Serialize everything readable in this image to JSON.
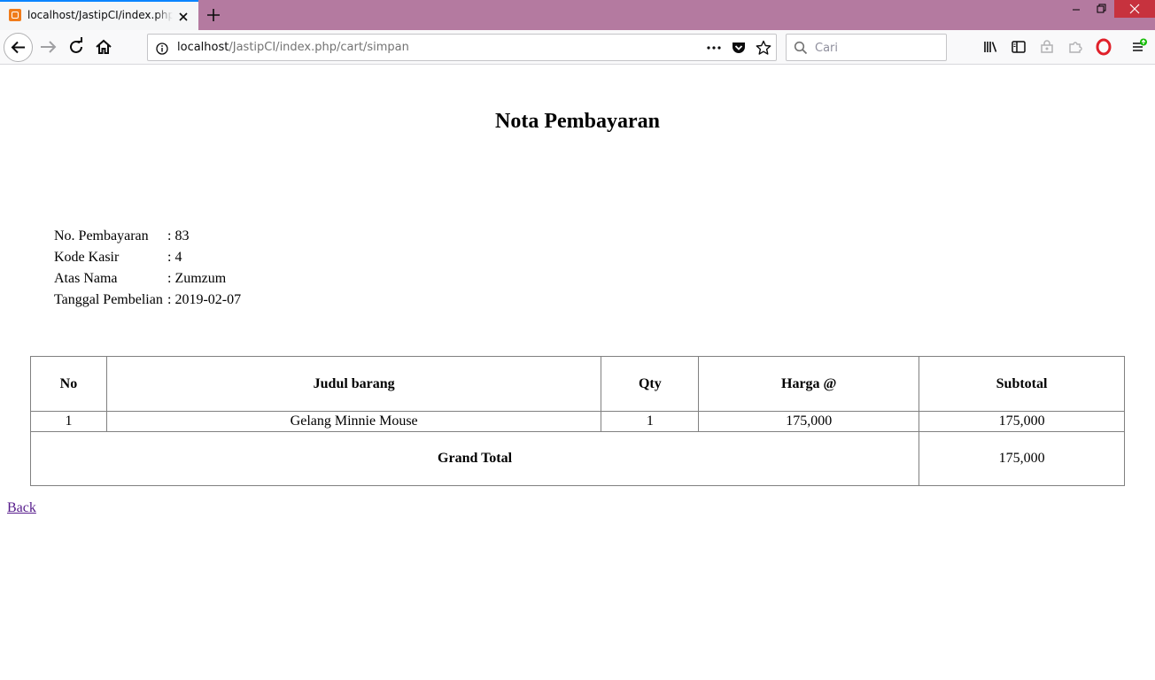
{
  "browser": {
    "tab": {
      "title": "localhost/JastipCI/index.php/cart/simpan"
    },
    "url": {
      "host": "localhost",
      "path": "/JastipCI/index.php/cart/simpan"
    },
    "search": {
      "placeholder": "Cari"
    },
    "icons": {
      "back": "back-arrow-icon",
      "forward": "forward-arrow-icon",
      "reload": "reload-icon",
      "home": "home-icon",
      "info": "info-icon",
      "page-actions": "more-dots-icon",
      "pocket": "pocket-icon",
      "bookmark": "star-icon",
      "library": "library-icon",
      "sidebar": "sidebar-icon",
      "menu": "hamburger-icon"
    },
    "accent_color": "#0a84ff",
    "titlebar_color": "#b47aa0"
  },
  "page": {
    "title": "Nota Pembayaran",
    "info": [
      {
        "label": "No. Pembayaran",
        "value": ": 83"
      },
      {
        "label": "Kode Kasir",
        "value": ": 4"
      },
      {
        "label": "Atas Nama",
        "value": ": Zumzum"
      },
      {
        "label": "Tanggal Pembelian",
        "value": ": 2019-02-07"
      }
    ],
    "table": {
      "headers": [
        "No",
        "Judul barang",
        "Qty",
        "Harga @",
        "Subtotal"
      ],
      "rows": [
        [
          "1",
          "Gelang Minnie Mouse",
          "1",
          "175,000",
          "175,000"
        ]
      ],
      "grand_total_label": "Grand Total",
      "grand_total_value": "175,000"
    },
    "back_link": "Back",
    "link_color": "#551a8b"
  }
}
